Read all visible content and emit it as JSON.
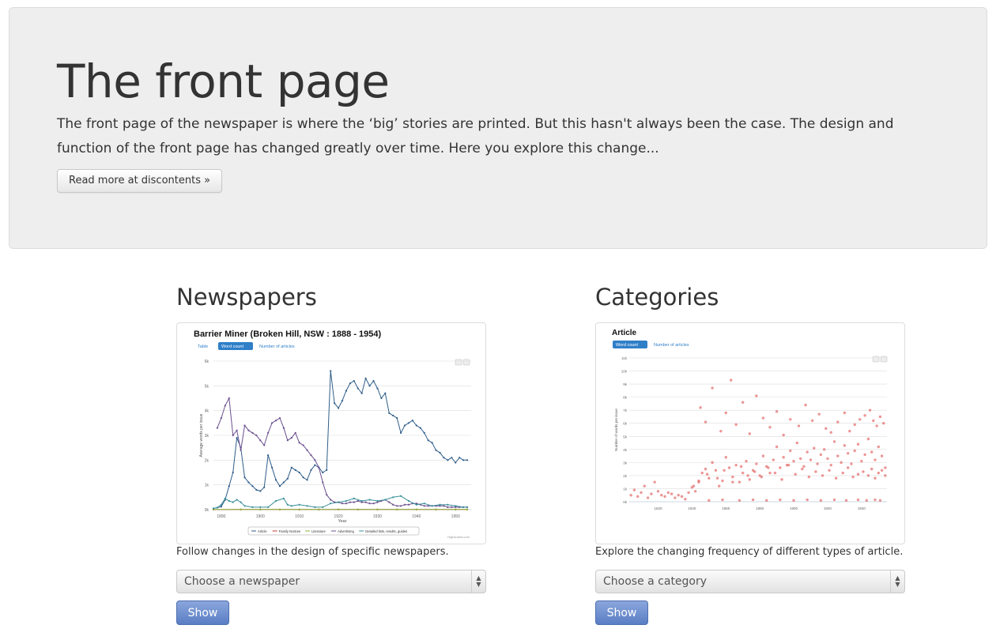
{
  "hero": {
    "title": "The front page",
    "description": "The front page of the newspaper is where the ‘big’ stories are printed. But this hasn't always been the case. The design and function of the front page has changed greatly over time. Here you explore this change...",
    "read_more_label": "Read more at discontents »"
  },
  "newspapers": {
    "heading": "Newspapers",
    "description": "Follow changes in the design of specific newspapers.",
    "select_placeholder": "Choose a newspaper",
    "show_label": "Show"
  },
  "categories": {
    "heading": "Categories",
    "description": "Explore the changing frequency of different types of article.",
    "select_placeholder": "Choose a category",
    "show_label": "Show"
  },
  "chart_data": [
    {
      "type": "line",
      "title": "Barrier Miner (Broken Hill, NSW : 1888 - 1954)",
      "view_buttons": [
        "Table",
        "Word count",
        "Number of articles"
      ],
      "active_view": "Word count",
      "xlabel": "Year",
      "ylabel": "Average words per issue",
      "xlim": [
        1888,
        1954
      ],
      "ylim": [
        0,
        6000
      ],
      "x_ticks": [
        "1890",
        "1900",
        "1910",
        "1920",
        "1930",
        "1940",
        "1950"
      ],
      "y_ticks": [
        "0k",
        "1k",
        "2k",
        "3k",
        "4k",
        "5k",
        "6k"
      ],
      "credit": "Highcharts.com",
      "series": [
        {
          "name": "Article",
          "color": "#2f5d8a",
          "x": [
            1888,
            1889,
            1890,
            1891,
            1892,
            1893,
            1894,
            1895,
            1896,
            1897,
            1898,
            1899,
            1900,
            1901,
            1902,
            1903,
            1904,
            1905,
            1906,
            1907,
            1908,
            1909,
            1910,
            1911,
            1912,
            1913,
            1914,
            1915,
            1916,
            1917,
            1918,
            1919,
            1920,
            1921,
            1922,
            1923,
            1924,
            1925,
            1926,
            1927,
            1928,
            1929,
            1930,
            1931,
            1932,
            1933,
            1934,
            1935,
            1936,
            1937,
            1938,
            1939,
            1940,
            1941,
            1942,
            1943,
            1944,
            1945,
            1946,
            1947,
            1948,
            1949,
            1950,
            1951,
            1952,
            1953
          ],
          "y": [
            50,
            80,
            120,
            400,
            950,
            1500,
            2900,
            2500,
            1300,
            1100,
            950,
            800,
            750,
            900,
            2200,
            1700,
            1200,
            950,
            1100,
            1250,
            1700,
            1600,
            1500,
            1300,
            1200,
            1600,
            1800,
            1700,
            1500,
            1600,
            5600,
            4300,
            4100,
            4400,
            4800,
            5100,
            5200,
            4900,
            4700,
            5300,
            5000,
            5200,
            4900,
            4500,
            4700,
            3900,
            3800,
            3700,
            3100,
            3400,
            3500,
            3600,
            3400,
            3300,
            3100,
            2800,
            2700,
            2400,
            2300,
            2100,
            2000,
            2100,
            1900,
            2100,
            2000,
            2000
          ]
        },
        {
          "name": "Family Notices",
          "color": "#c0392b",
          "x": [
            1888,
            1895,
            1900,
            1905,
            1910,
            1915,
            1920,
            1925,
            1930,
            1935,
            1940,
            1945,
            1950,
            1953
          ],
          "y": [
            0,
            5,
            5,
            5,
            5,
            5,
            5,
            5,
            5,
            5,
            5,
            5,
            5,
            5
          ]
        },
        {
          "name": "Literature",
          "color": "#8bb33a",
          "x": [
            1888,
            1895,
            1900,
            1905,
            1910,
            1915,
            1920,
            1925,
            1930,
            1935,
            1940,
            1945,
            1950,
            1953
          ],
          "y": [
            5,
            10,
            10,
            10,
            10,
            10,
            10,
            10,
            10,
            10,
            10,
            10,
            10,
            10
          ]
        },
        {
          "name": "Advertising",
          "color": "#6b4f8f",
          "x": [
            1889,
            1890,
            1891,
            1892,
            1893,
            1894,
            1895,
            1896,
            1897,
            1898,
            1899,
            1900,
            1901,
            1902,
            1903,
            1904,
            1905,
            1906,
            1907,
            1908,
            1909,
            1910,
            1911,
            1912,
            1913,
            1914,
            1915,
            1916,
            1917,
            1918,
            1919,
            1920,
            1921,
            1922,
            1923,
            1924,
            1925,
            1926,
            1927,
            1928,
            1929,
            1930,
            1931,
            1932,
            1933,
            1934,
            1935,
            1936,
            1937,
            1938,
            1939,
            1940,
            1941,
            1942,
            1943,
            1944,
            1945,
            1946,
            1947,
            1948,
            1949,
            1950,
            1951,
            1952,
            1953
          ],
          "y": [
            3300,
            3700,
            4200,
            4500,
            3000,
            3200,
            2400,
            3400,
            3200,
            3100,
            3000,
            2800,
            2600,
            3100,
            3500,
            3600,
            3700,
            3300,
            2800,
            2900,
            3100,
            2700,
            2600,
            2400,
            2200,
            2000,
            1700,
            1100,
            600,
            400,
            300,
            300,
            250,
            250,
            300,
            300,
            350,
            300,
            300,
            250,
            250,
            300,
            350,
            400,
            300,
            200,
            150,
            150,
            200,
            200,
            250,
            250,
            200,
            150,
            150,
            150,
            150,
            150,
            150,
            100,
            100,
            100,
            100,
            100,
            100
          ]
        },
        {
          "name": "Detailed lists, results, guides",
          "color": "#3a8f9a",
          "x": [
            1888,
            1889,
            1890,
            1891,
            1892,
            1893,
            1894,
            1895,
            1896,
            1898,
            1900,
            1902,
            1904,
            1906,
            1907,
            1908,
            1910,
            1912,
            1914,
            1916,
            1918,
            1920,
            1922,
            1924,
            1926,
            1928,
            1930,
            1932,
            1934,
            1936,
            1938,
            1940,
            1942,
            1944,
            1946,
            1948,
            1950,
            1952,
            1953
          ],
          "y": [
            50,
            80,
            200,
            450,
            350,
            300,
            400,
            300,
            150,
            100,
            100,
            100,
            350,
            450,
            200,
            150,
            200,
            150,
            100,
            100,
            250,
            300,
            350,
            450,
            350,
            400,
            350,
            400,
            500,
            550,
            350,
            200,
            250,
            150,
            200,
            200,
            150,
            100,
            100
          ]
        }
      ]
    },
    {
      "type": "scatter",
      "title": "Article",
      "view_buttons": [
        "Word count",
        "Number of articles"
      ],
      "active_view": "Word count",
      "ylabel": "Number of words per issue",
      "xlim": [
        1803,
        1955
      ],
      "ylim": [
        0,
        11000
      ],
      "x_ticks": [
        "1820",
        "1840",
        "1860",
        "1880",
        "1900",
        "1920",
        "1940"
      ],
      "y_ticks": [
        "0k",
        "1k",
        "2k",
        "3k",
        "4k",
        "5k",
        "6k",
        "7k",
        "8k",
        "9k",
        "10k",
        "11k"
      ],
      "color": "#e05050",
      "x": [
        1804,
        1806,
        1808,
        1810,
        1812,
        1814,
        1816,
        1818,
        1820,
        1822,
        1824,
        1826,
        1828,
        1830,
        1832,
        1834,
        1836,
        1838,
        1840,
        1842,
        1844,
        1846,
        1848,
        1850,
        1852,
        1854,
        1856,
        1858,
        1860,
        1862,
        1864,
        1866,
        1868,
        1870,
        1872,
        1874,
        1876,
        1878,
        1880,
        1882,
        1884,
        1886,
        1888,
        1890,
        1892,
        1894,
        1896,
        1898,
        1900,
        1902,
        1904,
        1906,
        1908,
        1910,
        1912,
        1914,
        1916,
        1918,
        1920,
        1922,
        1924,
        1926,
        1928,
        1930,
        1932,
        1934,
        1936,
        1938,
        1940,
        1942,
        1944,
        1946,
        1948,
        1950,
        1952,
        1954,
        1845,
        1848,
        1852,
        1857,
        1860,
        1863,
        1866,
        1870,
        1874,
        1878,
        1882,
        1886,
        1890,
        1894,
        1898,
        1903,
        1907,
        1911,
        1915,
        1919,
        1922,
        1926,
        1930,
        1933,
        1936,
        1939,
        1942,
        1945,
        1947,
        1949,
        1951,
        1953,
        1841,
        1844,
        1849,
        1855,
        1859,
        1864,
        1869,
        1873,
        1877,
        1881,
        1885,
        1889,
        1893,
        1897,
        1901,
        1905,
        1909,
        1913,
        1917,
        1921,
        1925,
        1929,
        1932,
        1935,
        1938,
        1941,
        1944,
        1946,
        1948,
        1950,
        1952,
        1954,
        1850,
        1858,
        1868,
        1876,
        1884,
        1892,
        1900,
        1908,
        1916,
        1924,
        1931,
        1938,
        1943,
        1948,
        1951
      ],
      "y": [
        500,
        900,
        400,
        700,
        1200,
        300,
        600,
        1500,
        800,
        500,
        400,
        700,
        600,
        300,
        500,
        400,
        200,
        700,
        1100,
        800,
        1500,
        2200,
        2500,
        1800,
        3000,
        2400,
        1200,
        1600,
        3400,
        2600,
        1900,
        2800,
        1500,
        2200,
        3100,
        1700,
        2400,
        2900,
        2000,
        3500,
        2700,
        2200,
        3200,
        4200,
        2600,
        3400,
        2800,
        3900,
        3100,
        4500,
        3300,
        2700,
        3800,
        3200,
        4100,
        2900,
        3600,
        4000,
        3300,
        2800,
        4600,
        3500,
        3000,
        4300,
        3700,
        2900,
        3900,
        4400,
        3100,
        3600,
        4800,
        3800,
        3200,
        4200,
        3500,
        2600,
        7200,
        6100,
        8700,
        5400,
        6800,
        9300,
        5900,
        7600,
        5200,
        8100,
        6400,
        5700,
        6900,
        5100,
        6300,
        5800,
        7400,
        6200,
        6700,
        5600,
        5300,
        6100,
        6800,
        5400,
        5900,
        6300,
        6600,
        7000,
        6200,
        5800,
        6500,
        6000,
        1200,
        1600,
        2100,
        1800,
        2400,
        1500,
        2700,
        2000,
        2300,
        1900,
        2600,
        2200,
        1700,
        2800,
        2100,
        2500,
        1900,
        2300,
        2000,
        2400,
        1800,
        2200,
        2600,
        1900,
        2100,
        2300,
        2000,
        2500,
        1800,
        2200,
        2400,
        2000,
        100,
        150,
        100,
        150,
        100,
        150,
        100,
        150,
        100,
        150,
        100,
        150,
        100,
        150,
        100
      ]
    }
  ]
}
